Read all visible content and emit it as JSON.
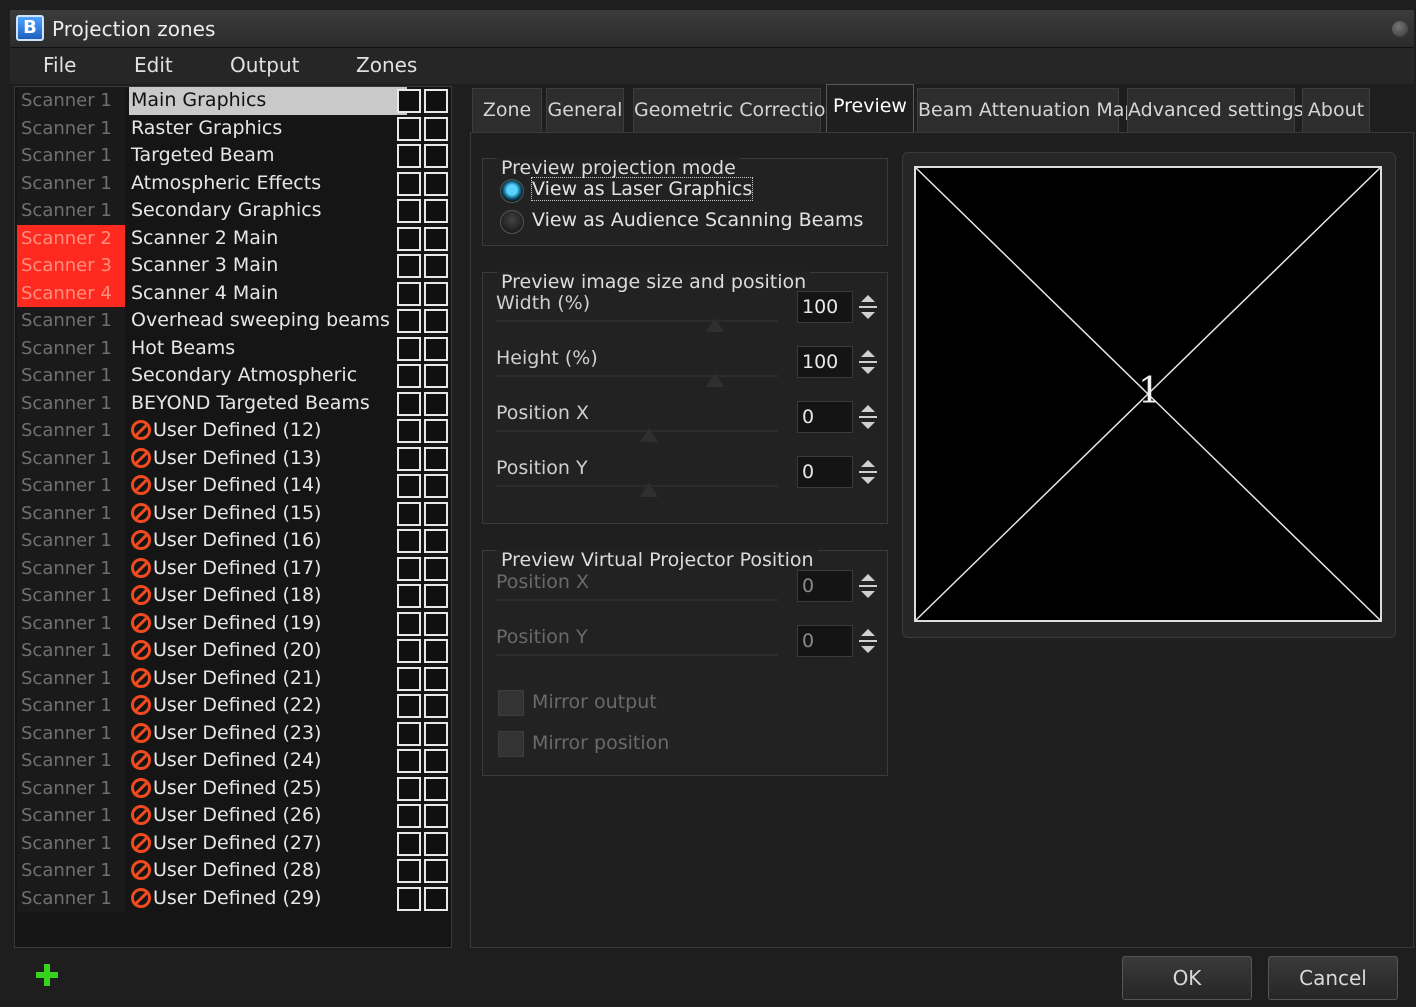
{
  "window": {
    "title": "Projection zones"
  },
  "menu": [
    "File",
    "Edit",
    "Output",
    "Zones"
  ],
  "zones": [
    {
      "scanner": "Scanner 1",
      "name": "Main Graphics",
      "selected": true,
      "disabled": false,
      "active": false
    },
    {
      "scanner": "Scanner 1",
      "name": "Raster Graphics",
      "disabled": false,
      "active": false
    },
    {
      "scanner": "Scanner 1",
      "name": "Targeted Beam",
      "disabled": false,
      "active": false
    },
    {
      "scanner": "Scanner 1",
      "name": "Atmospheric Effects",
      "disabled": false,
      "active": false
    },
    {
      "scanner": "Scanner 1",
      "name": "Secondary Graphics",
      "disabled": false,
      "active": false
    },
    {
      "scanner": "Scanner 2",
      "name": "Scanner 2 Main",
      "disabled": false,
      "active": true
    },
    {
      "scanner": "Scanner 3",
      "name": "Scanner 3 Main",
      "disabled": false,
      "active": true
    },
    {
      "scanner": "Scanner 4",
      "name": "Scanner 4 Main",
      "disabled": false,
      "active": true
    },
    {
      "scanner": "Scanner 1",
      "name": "Overhead sweeping beams",
      "disabled": false,
      "active": false
    },
    {
      "scanner": "Scanner 1",
      "name": "Hot Beams",
      "disabled": false,
      "active": false
    },
    {
      "scanner": "Scanner 1",
      "name": "Secondary Atmospheric",
      "disabled": false,
      "active": false
    },
    {
      "scanner": "Scanner 1",
      "name": "BEYOND Targeted Beams",
      "disabled": false,
      "active": false
    },
    {
      "scanner": "Scanner 1",
      "name": "User Defined (12)",
      "disabled": true,
      "active": false
    },
    {
      "scanner": "Scanner 1",
      "name": "User Defined (13)",
      "disabled": true,
      "active": false
    },
    {
      "scanner": "Scanner 1",
      "name": "User Defined (14)",
      "disabled": true,
      "active": false
    },
    {
      "scanner": "Scanner 1",
      "name": "User Defined (15)",
      "disabled": true,
      "active": false
    },
    {
      "scanner": "Scanner 1",
      "name": "User Defined (16)",
      "disabled": true,
      "active": false
    },
    {
      "scanner": "Scanner 1",
      "name": "User Defined (17)",
      "disabled": true,
      "active": false
    },
    {
      "scanner": "Scanner 1",
      "name": "User Defined (18)",
      "disabled": true,
      "active": false
    },
    {
      "scanner": "Scanner 1",
      "name": "User Defined (19)",
      "disabled": true,
      "active": false
    },
    {
      "scanner": "Scanner 1",
      "name": "User Defined (20)",
      "disabled": true,
      "active": false
    },
    {
      "scanner": "Scanner 1",
      "name": "User Defined (21)",
      "disabled": true,
      "active": false
    },
    {
      "scanner": "Scanner 1",
      "name": "User Defined (22)",
      "disabled": true,
      "active": false
    },
    {
      "scanner": "Scanner 1",
      "name": "User Defined (23)",
      "disabled": true,
      "active": false
    },
    {
      "scanner": "Scanner 1",
      "name": "User Defined (24)",
      "disabled": true,
      "active": false
    },
    {
      "scanner": "Scanner 1",
      "name": "User Defined (25)",
      "disabled": true,
      "active": false
    },
    {
      "scanner": "Scanner 1",
      "name": "User Defined (26)",
      "disabled": true,
      "active": false
    },
    {
      "scanner": "Scanner 1",
      "name": "User Defined (27)",
      "disabled": true,
      "active": false
    },
    {
      "scanner": "Scanner 1",
      "name": "User Defined (28)",
      "disabled": true,
      "active": false
    },
    {
      "scanner": "Scanner 1",
      "name": "User Defined (29)",
      "disabled": true,
      "active": false
    }
  ],
  "tabs": [
    {
      "label": "Zone"
    },
    {
      "label": "General"
    },
    {
      "label": "Geometric Correction"
    },
    {
      "label": "Preview",
      "active": true
    },
    {
      "label": "Beam Attenuation Map"
    },
    {
      "label": "Advanced settings"
    },
    {
      "label": "About"
    }
  ],
  "projection_mode": {
    "title": "Preview projection mode",
    "options": [
      "View as Laser Graphics",
      "View as Audience Scanning Beams"
    ],
    "selected": "View as Laser Graphics"
  },
  "image_size": {
    "title": "Preview image size and position",
    "fields": [
      {
        "label": "Width (%)",
        "value": "100"
      },
      {
        "label": "Height (%)",
        "value": "100"
      },
      {
        "label": "Position X",
        "value": "0"
      },
      {
        "label": "Position Y",
        "value": "0"
      }
    ]
  },
  "virtual_projector": {
    "title": "Preview Virtual Projector Position",
    "fields": [
      {
        "label": "Position X",
        "value": "0"
      },
      {
        "label": "Position Y",
        "value": "0"
      }
    ],
    "checkboxes": [
      "Mirror output",
      "Mirror position"
    ]
  },
  "preview": {
    "label": "1"
  },
  "buttons": {
    "ok": "OK",
    "cancel": "Cancel"
  },
  "icons": {
    "app": "beyond-logo-icon",
    "add": "plus-icon",
    "disabled": "no-entry-icon"
  },
  "colors": {
    "scanner_active": "#ff2a1f",
    "disabled_icon": "#f04a1e",
    "add_icon": "#37d31c",
    "radio_checked": "#58d5ff"
  }
}
